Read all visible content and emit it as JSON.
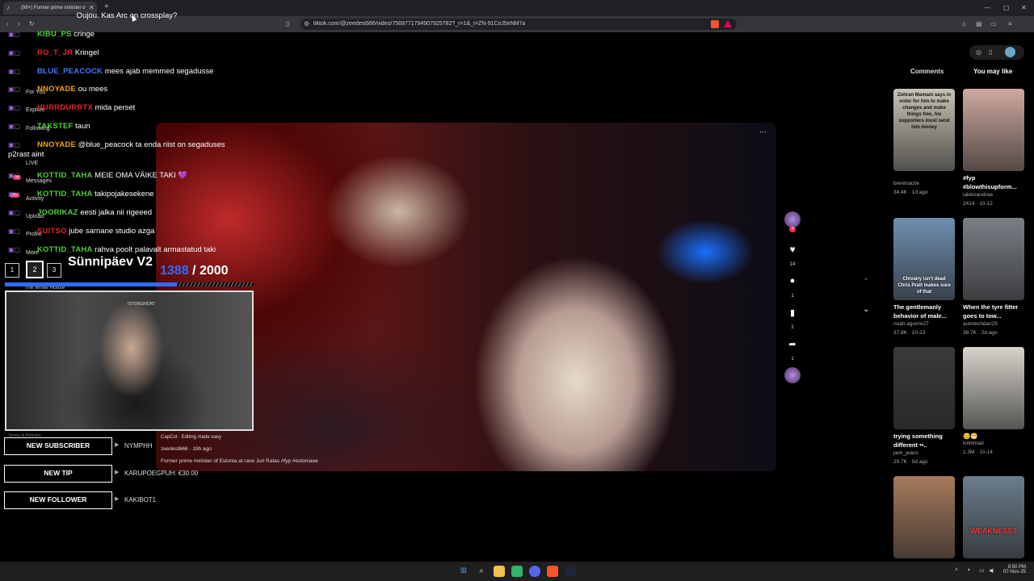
{
  "browser": {
    "tab_title": "(99+) Former prime minister o",
    "url": "tiktok.com/@zeedest666/video/7569771794907925782?_r=1&_t=ZN-91CoJ5eNM7a"
  },
  "tiktok": {
    "nav": [
      "For You",
      "Explore",
      "Following",
      "LIVE",
      "Messages",
      "Activity",
      "Upload",
      "Profile",
      "More"
    ],
    "badges": {
      "messages": "34",
      "activity": "99+"
    },
    "footer_link": "Terms & Policies",
    "following_account": "The White House",
    "video": {
      "capcut_label": "CapCut · Editing made easy",
      "author_line": "zeedest666 · 19h ago",
      "description": "Former prime minister of Estonia at rave Juri Ratas #fyp #estoniaee"
    },
    "actions": {
      "likes": "14",
      "comments": "1",
      "saves": "2",
      "shares": "1"
    },
    "right_tabs": {
      "comments": "Comments",
      "you_may_like": "You may like"
    },
    "cards": [
      {
        "title": "",
        "author": "brentnatzle",
        "likes": "34.4K",
        "age": "1d ago",
        "thumb_text": "Zohran Mamani says in order for him to make changes and make things free, his supporters must send him money",
        "thumb_color": "#c9c3b6"
      },
      {
        "title": "#fyp #blowthisupform...",
        "author": "ialeksandraa",
        "likes": "2414",
        "age": "10-12",
        "thumb_text": "",
        "thumb_color": "#cfa9a0"
      },
      {
        "title": "The gentlemanly behavior of male...",
        "author": "noah.aguirre27",
        "likes": "37.8K",
        "age": "10-23",
        "thumb_text": "Chivalry isn't dead Chris Pratt makes sure of that",
        "thumb_color": "#6f8fb0"
      },
      {
        "title": "When the tyre fitter goes to tow...",
        "author": "autotechdan25",
        "likes": "38.7K",
        "age": "2d ago",
        "thumb_text": "",
        "thumb_color": "#7b7f86"
      },
      {
        "title": "trying something different ••..",
        "author": "jack_jeans",
        "likes": "29.7K",
        "age": "5d ago",
        "thumb_text": "",
        "thumb_color": "#3a3a3a"
      },
      {
        "title": "😊😁",
        "author": "kirklimad",
        "likes": "1.3M",
        "age": "10-14",
        "thumb_text": "",
        "thumb_color": "#d8d4cc"
      },
      {
        "title": "",
        "author": "",
        "likes": "",
        "age": "",
        "thumb_text": "",
        "thumb_color": "#a57a5c"
      },
      {
        "title": "",
        "author": "",
        "likes": "",
        "age": "",
        "thumb_text": "WEAKNESS?",
        "thumb_color": "#6b7d8c"
      }
    ]
  },
  "stream": {
    "chat": [
      {
        "name": "",
        "message": "Oujou. Kas Arc on crossplay?",
        "name_color": "#ff3b3b"
      },
      {
        "name": "KIBU_PS",
        "message": "cringe",
        "name_color": "#4cd137"
      },
      {
        "name": "RO_T_JR",
        "message": "Kringel",
        "name_color": "#e8222a"
      },
      {
        "name": "BLUE_PEACOCK",
        "message": "mees ajab memmed segadusse",
        "name_color": "#3b7bff"
      },
      {
        "name": "NNOYADE",
        "message": "ou mees",
        "name_color": "#f0a500"
      },
      {
        "name": "HURRDURRTX",
        "message": "mida perset",
        "name_color": "#e8222a"
      },
      {
        "name": "TAKSTEF",
        "message": "taun",
        "name_color": "#4cd137"
      },
      {
        "name": "NNOYADE",
        "message": "@blue_peacock ta enda riist on segaduses",
        "name_color": "#f0a500"
      },
      {
        "name": "KOTTID_TAHA",
        "message": "MEIE OMA VÄIKE TAKI 💜",
        "name_color": "#4cd137"
      },
      {
        "name": "KOTTID_TAHA",
        "message": "takipojakesekene",
        "name_color": "#4cd137"
      },
      {
        "name": "JOORIKAZ",
        "message": "eesti jalka nii rigeeed",
        "name_color": "#4cd137"
      },
      {
        "name": "SUITSO",
        "message": "jube sarnane studio azga",
        "name_color": "#e8222a"
      },
      {
        "name": "KOTTID_TAHA",
        "message": "rahva poolt palavalt armastatud taki",
        "name_color": "#4cd137"
      }
    ],
    "chat_wrap_text": "p2rast aint",
    "goal": {
      "steps": [
        "1",
        "2",
        "3"
      ],
      "title": "Sünnipäev V2",
      "current": "1388",
      "separator": " / ",
      "target": "2000",
      "progress": 0.69
    },
    "webcam_label": "ISTORGRIDNT",
    "alerts": [
      {
        "label": "NEW SUBSCRIBER",
        "value": "NYMPHH"
      },
      {
        "label": "NEW TIP",
        "value": "KARUPOEGPUH: €30.00"
      },
      {
        "label": "NEW FOLLOWER",
        "value": "KAKIBOT1"
      }
    ]
  },
  "taskbar": {
    "time": "9:50 PM",
    "date": "07-Nov-25"
  },
  "colors": {
    "accent_blue": "#3b7bff",
    "tiktok_red": "#fe2c55",
    "goal_blue": "#2f6bff"
  }
}
